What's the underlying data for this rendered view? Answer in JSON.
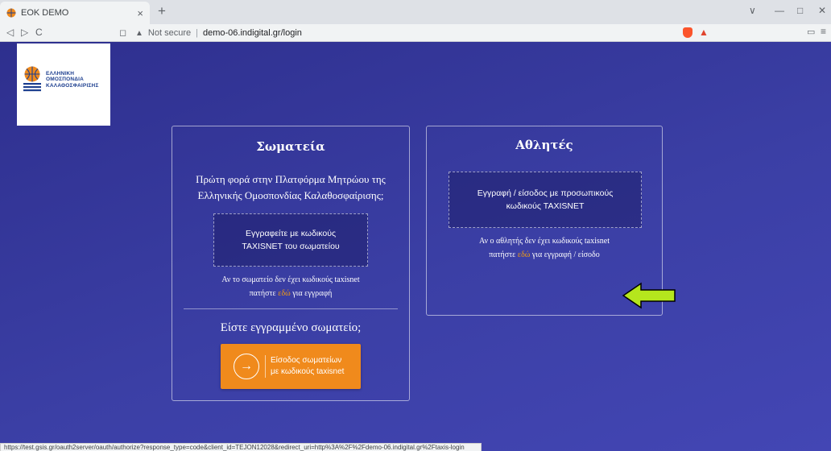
{
  "browser": {
    "tab_title": "EOK DEMO",
    "tab_close": "×",
    "new_tab": "+",
    "back": "◁",
    "forward": "▷",
    "reload": "C",
    "security_label": "Not secure",
    "url": "demo-06.indigital.gr/login",
    "win_minimize": "—",
    "win_maximize": "□",
    "win_close": "✕",
    "win_dropdown": "∨",
    "status_url": "https://test.gsis.gr/oauth2server/oauth/authorize?response_type=code&client_id=TEJON12028&redirect_uri=http%3A%2F%2Fdemo-06.indigital.gr%2Ftaxis-login"
  },
  "logo": {
    "line1": "ΕΛΛΗΝΙΚΗ",
    "line2": "ΟΜΟΣΠΟΝΔΙΑ",
    "line3": "ΚΑΛΑΘΟΣΦΑΙΡΙΣΗΣ"
  },
  "clubs_card": {
    "title": "Σωματεία",
    "intro_line1": "Πρώτη φορά στην Πλατφόρμα Μητρώου της",
    "intro_line2": "Ελληνικής Ομοσπονδίας Καλαθοσφαίρισης;",
    "register_line1": "Εγγραφείτε με κωδικούς",
    "register_line2": "TAXISNET του σωματείου",
    "no_taxis_line1": "Αν το σωματείο δεν έχει κωδικούς taxisnet",
    "no_taxis_prefix": "πατήστε",
    "no_taxis_link": "εδώ",
    "no_taxis_suffix": "για εγγραφή",
    "registered_title": "Είστε εγγραμμένο σωματείο;",
    "login_line1": "Είσοδος σωματείων",
    "login_line2": "με κωδικούς taxisnet"
  },
  "athletes_card": {
    "title": "Αθλητές",
    "register_line1": "Εγγραφή / είσοδος με προσωπικούς",
    "register_line2": "κωδικούς TAXISNET",
    "no_taxis_line1": "Αν ο αθλητής δεν έχει κωδικούς taxisnet",
    "no_taxis_prefix": "πατήστε",
    "no_taxis_link": "εδώ",
    "no_taxis_suffix": "για εγγραφή / είσοδο"
  },
  "colors": {
    "background": "#3b3fa5",
    "accent_orange": "#f08a1c",
    "link": "#f39c12",
    "arrow": "#b5e61d"
  }
}
